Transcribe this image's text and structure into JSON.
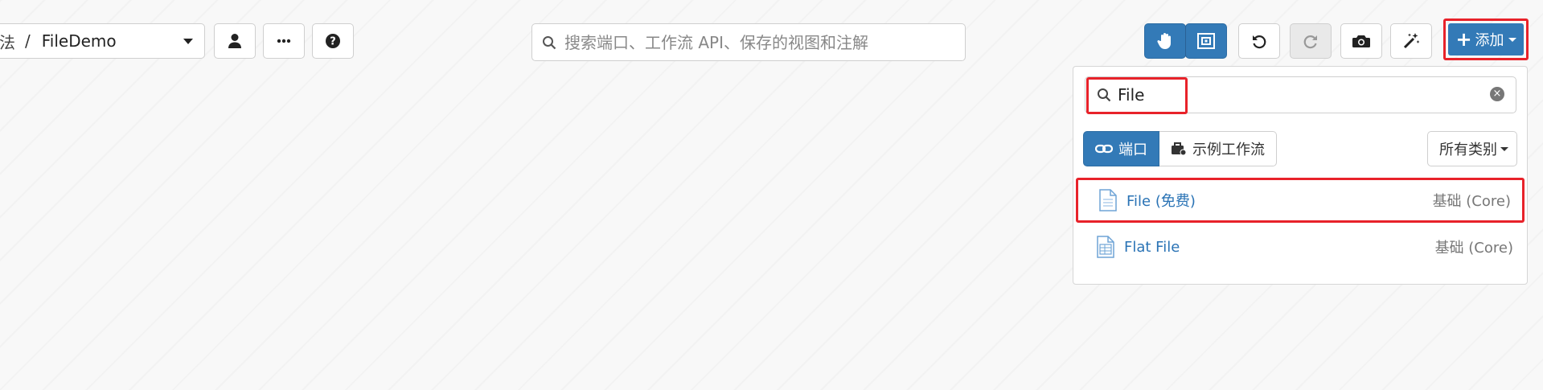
{
  "breadcrumb": {
    "cut_text": "法",
    "separator": "/",
    "current": "FileDemo"
  },
  "toolbar_left": {
    "user_icon": "user-icon",
    "more_icon": "ellipsis-icon",
    "help_icon": "question-circle-icon"
  },
  "search": {
    "placeholder": "搜索端口、工作流 API、保存的视图和注解"
  },
  "toolbar_right": {
    "pan_icon": "hand-icon",
    "fit_icon": "fit-view-icon",
    "undo_icon": "undo-icon",
    "redo_icon": "redo-icon",
    "camera_icon": "camera-icon",
    "magic_icon": "magic-wand-icon",
    "add_label": "添加"
  },
  "add_panel": {
    "filter_value": "File",
    "tabs": [
      {
        "label": "端口",
        "icon": "link-icon",
        "active": true
      },
      {
        "label": "示例工作流",
        "icon": "briefcase-icon",
        "active": false
      }
    ],
    "category_label": "所有类别",
    "results": [
      {
        "label": "File (免费)",
        "meta": "基础 (Core)",
        "icon": "file-icon"
      },
      {
        "label": "Flat File",
        "meta": "基础 (Core)",
        "icon": "flat-file-icon"
      }
    ]
  },
  "colors": {
    "primary": "#337ab7",
    "highlight": "#e8222a",
    "link": "#2a73b5"
  }
}
